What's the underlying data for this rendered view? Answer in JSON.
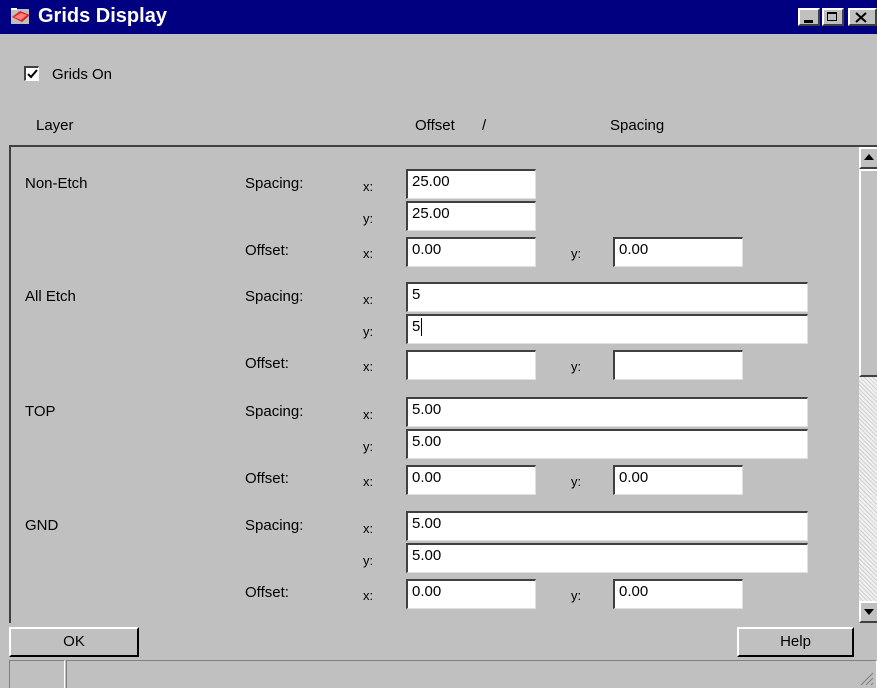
{
  "window": {
    "title": "Grids Display"
  },
  "grids_on": {
    "label": "Grids On",
    "checked": true
  },
  "header": {
    "layer": "Layer",
    "offset": "Offset",
    "slash": "/",
    "spacing": "Spacing"
  },
  "labels": {
    "spacing": "Spacing:",
    "offset": "Offset:",
    "x": "x:",
    "y": "y:"
  },
  "layers": [
    {
      "name": "Non-Etch",
      "spacing_x": "25.00",
      "spacing_y": "25.00",
      "offset_x": "0.00",
      "offset_y": "0.00"
    },
    {
      "name": "All Etch",
      "spacing_x": "5",
      "spacing_y": "5",
      "offset_x": "",
      "offset_y": ""
    },
    {
      "name": "TOP",
      "spacing_x": "5.00",
      "spacing_y": "5.00",
      "offset_x": "0.00",
      "offset_y": "0.00"
    },
    {
      "name": "GND",
      "spacing_x": "5.00",
      "spacing_y": "5.00",
      "offset_x": "0.00",
      "offset_y": "0.00"
    }
  ],
  "buttons": {
    "ok": "OK",
    "help": "Help"
  }
}
